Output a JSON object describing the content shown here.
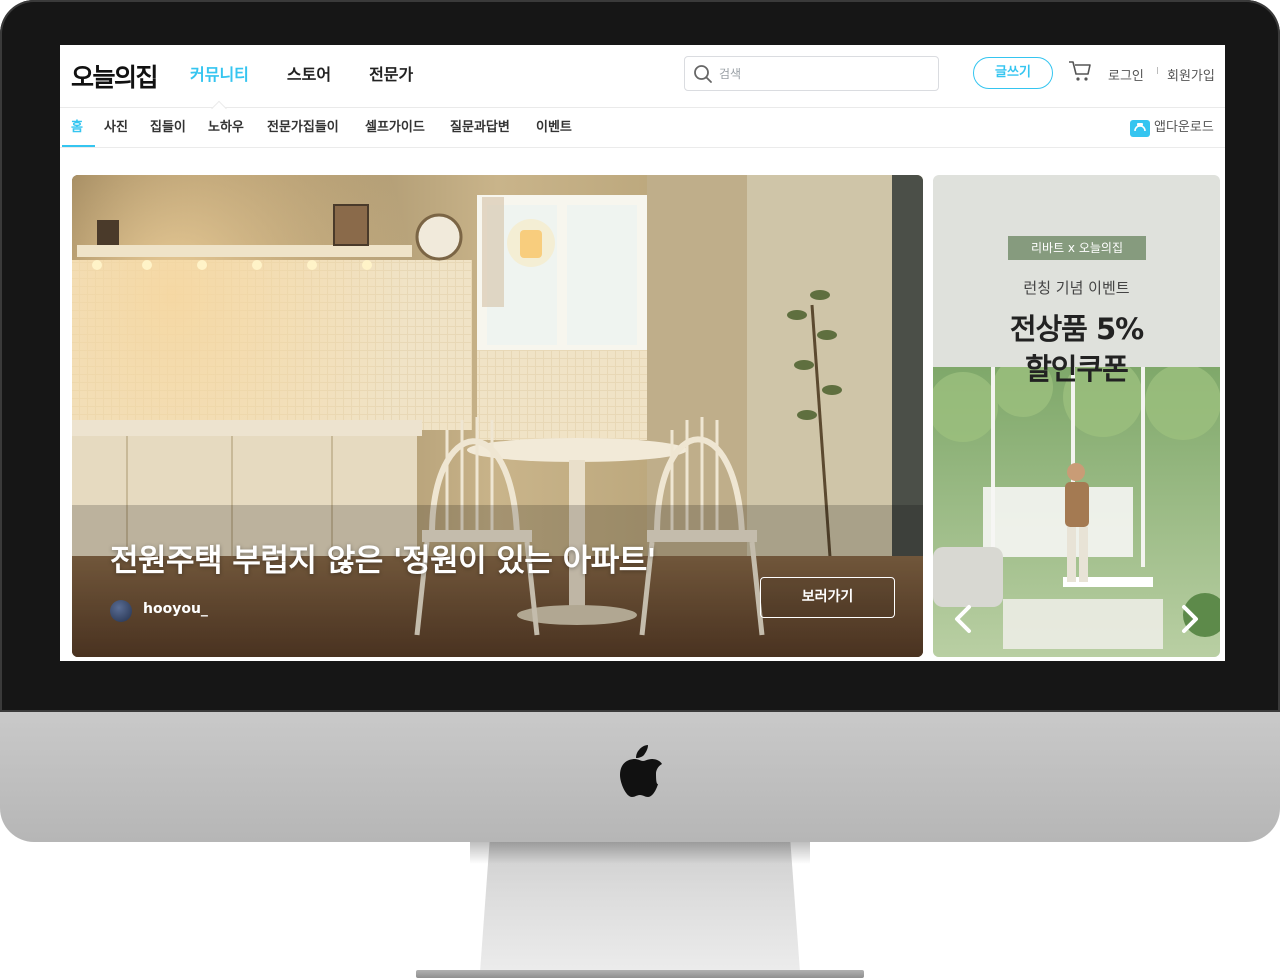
{
  "header": {
    "logo": "오늘의집",
    "nav": [
      "커뮤니티",
      "스토어",
      "전문가"
    ],
    "search_placeholder": "검색",
    "write_label": "글쓰기",
    "login_label": "로그인",
    "separator": "I",
    "signup_label": "회원가입"
  },
  "sub_nav": {
    "items": [
      "홈",
      "사진",
      "집들이",
      "노하우",
      "전문가집들이",
      "셀프가이드",
      "질문과답변",
      "이벤트"
    ],
    "app_download": "앱다운로드"
  },
  "hero": {
    "title": "전원주택 부럽지 않은 '정원이 있는 아파트'",
    "author": "hooyou_",
    "button_label": "보러가기"
  },
  "banner": {
    "badge": "리바트 x 오늘의집",
    "subtitle": "런칭 기념 이벤트",
    "headline_line1": "전상품 5%",
    "headline_line2": "할인쿠폰"
  },
  "colors": {
    "accent": "#35c5f0",
    "badge_green": "#869b7e"
  },
  "icons": [
    "search-icon",
    "cart-icon",
    "app-download-icon",
    "chevron-left-icon",
    "chevron-right-icon",
    "apple-logo-icon"
  ]
}
